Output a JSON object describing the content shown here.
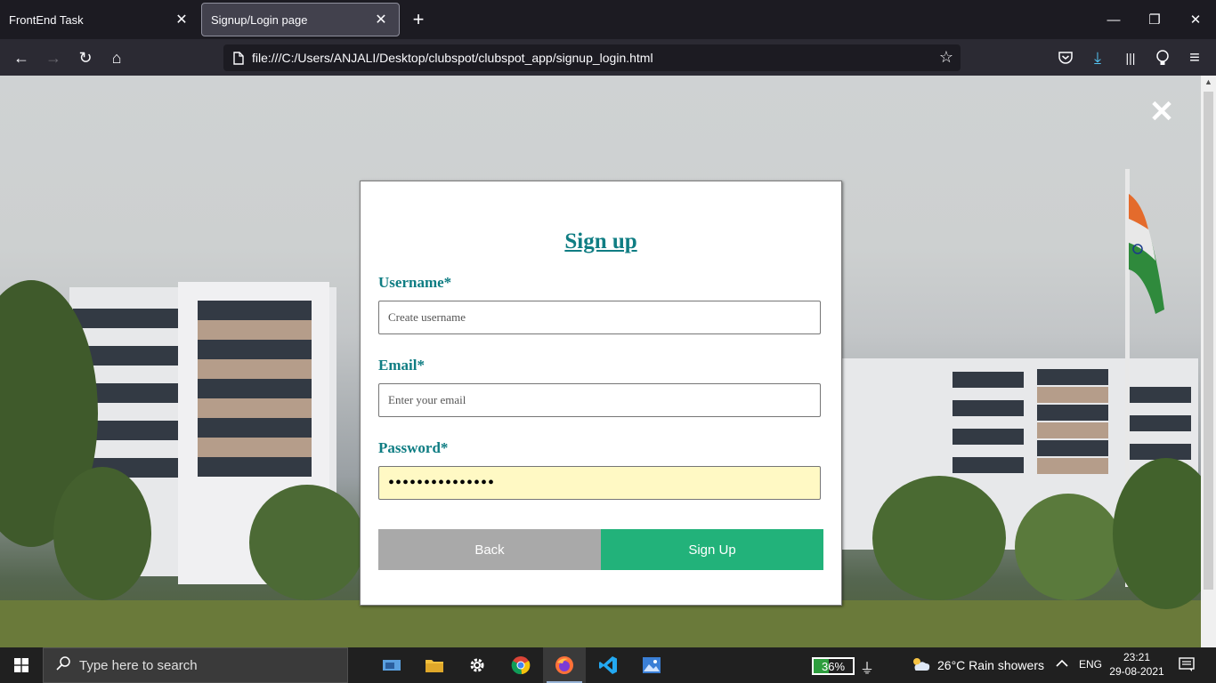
{
  "browser": {
    "tabs": [
      {
        "title": "FrontEnd Task",
        "close": "✕"
      },
      {
        "title": "Signup/Login page",
        "close": "✕"
      }
    ],
    "new_tab_icon": "+",
    "window_controls": {
      "minimize": "—",
      "restore": "❐",
      "close": "✕"
    },
    "url": "file:///C:/Users/ANJALI/Desktop/clubspot/clubspot_app/signup_login.html",
    "icons": {
      "back": "←",
      "forward": "→",
      "reload": "↻",
      "home": "⌂",
      "bookmark": "☆",
      "pocket": "⍓",
      "downloads": "⤓",
      "library": "|||",
      "extension": "●",
      "menu": "≡"
    }
  },
  "page": {
    "close_icon": "✕",
    "form": {
      "title": "Sign up",
      "username_label": "Username*",
      "username_placeholder": "Create username",
      "email_label": "Email*",
      "email_placeholder": "Enter your email",
      "password_label": "Password*",
      "password_value": "•••••••••••••••",
      "back_label": "Back",
      "signup_label": "Sign Up"
    }
  },
  "taskbar": {
    "search_placeholder": "Type here to search",
    "battery_percent": "36%",
    "weather": "26°C  Rain showers",
    "language": "ENG",
    "time": "23:21",
    "date": "29-08-2021",
    "tray_chevron": "^",
    "colors": {
      "accent": "#22b27a",
      "form_title": "#0f7d83",
      "back_btn": "#a9a9a9"
    }
  }
}
